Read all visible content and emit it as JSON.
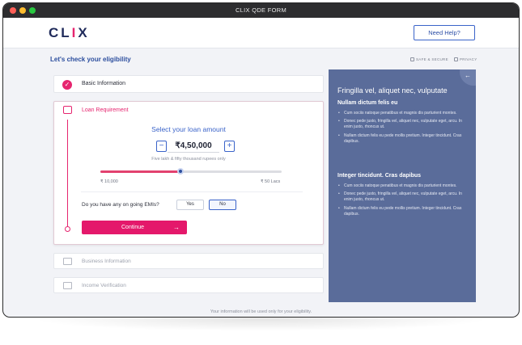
{
  "window": {
    "title": "CLIX QDE FORM"
  },
  "header": {
    "logo_main": "CL",
    "logo_accent": "I",
    "logo_end": "X",
    "help_label": "Need Help?"
  },
  "page": {
    "title": "Let's check your eligibility",
    "safe_label": "SAFE & SECURE",
    "privacy_label": "PRIVACY"
  },
  "steps": {
    "basic": "Basic Information",
    "loan": "Loan Requirement",
    "business": "Business Information",
    "income": "Income Verification"
  },
  "loan": {
    "heading": "Select your loan amount",
    "minus_label": "−",
    "plus_label": "+",
    "amount": "₹4,50,000",
    "amount_words": "Five lakh & fifty thousand rupees only",
    "slider_position_fraction": 0.44,
    "min_label": "₹ 10,000",
    "max_label": "₹ 50 Lacs",
    "emi_question": "Do you have any on going EMIs?",
    "yes_label": "Yes",
    "no_label": "No",
    "selected_emi": "No",
    "continue_label": "Continue",
    "continue_arrow": "→"
  },
  "side": {
    "back_icon": "←",
    "title": "Fringilla vel, aliquet nec, vulputate",
    "section1_heading": "Nullam dictum felis eu",
    "section1_items": [
      "Cum sociis natoque penatibus et magnis dis parturient montes.",
      "Donec pede justo, fringilla vel, aliquet nec, vulputate eget, arcu. In enim justo, rhoncus ut.",
      "Nullam dictum felis eu pede mollis pretium. Integer tincidunt. Cras dapibus."
    ],
    "section2_heading": "Integer tincidunt. Cras dapibus",
    "section2_items": [
      "Cum sociis natoque penatibus et magnis dis parturient montes.",
      "Donec pede justo, fringilla vel, aliquet nec, vulputate eget, arcu. In enim justo, rhoncus ut.",
      "Nullam dictum felis eu pede mollis pretium. Integer tincidunt. Cras dapibus."
    ]
  },
  "footer": {
    "note": "Your information will be used only for your eligibility."
  },
  "colors": {
    "brand_navy": "#1f2a5a",
    "accent_pink": "#e6256f",
    "link_blue": "#3a63c9",
    "panel_blue": "#5a6c9a"
  }
}
